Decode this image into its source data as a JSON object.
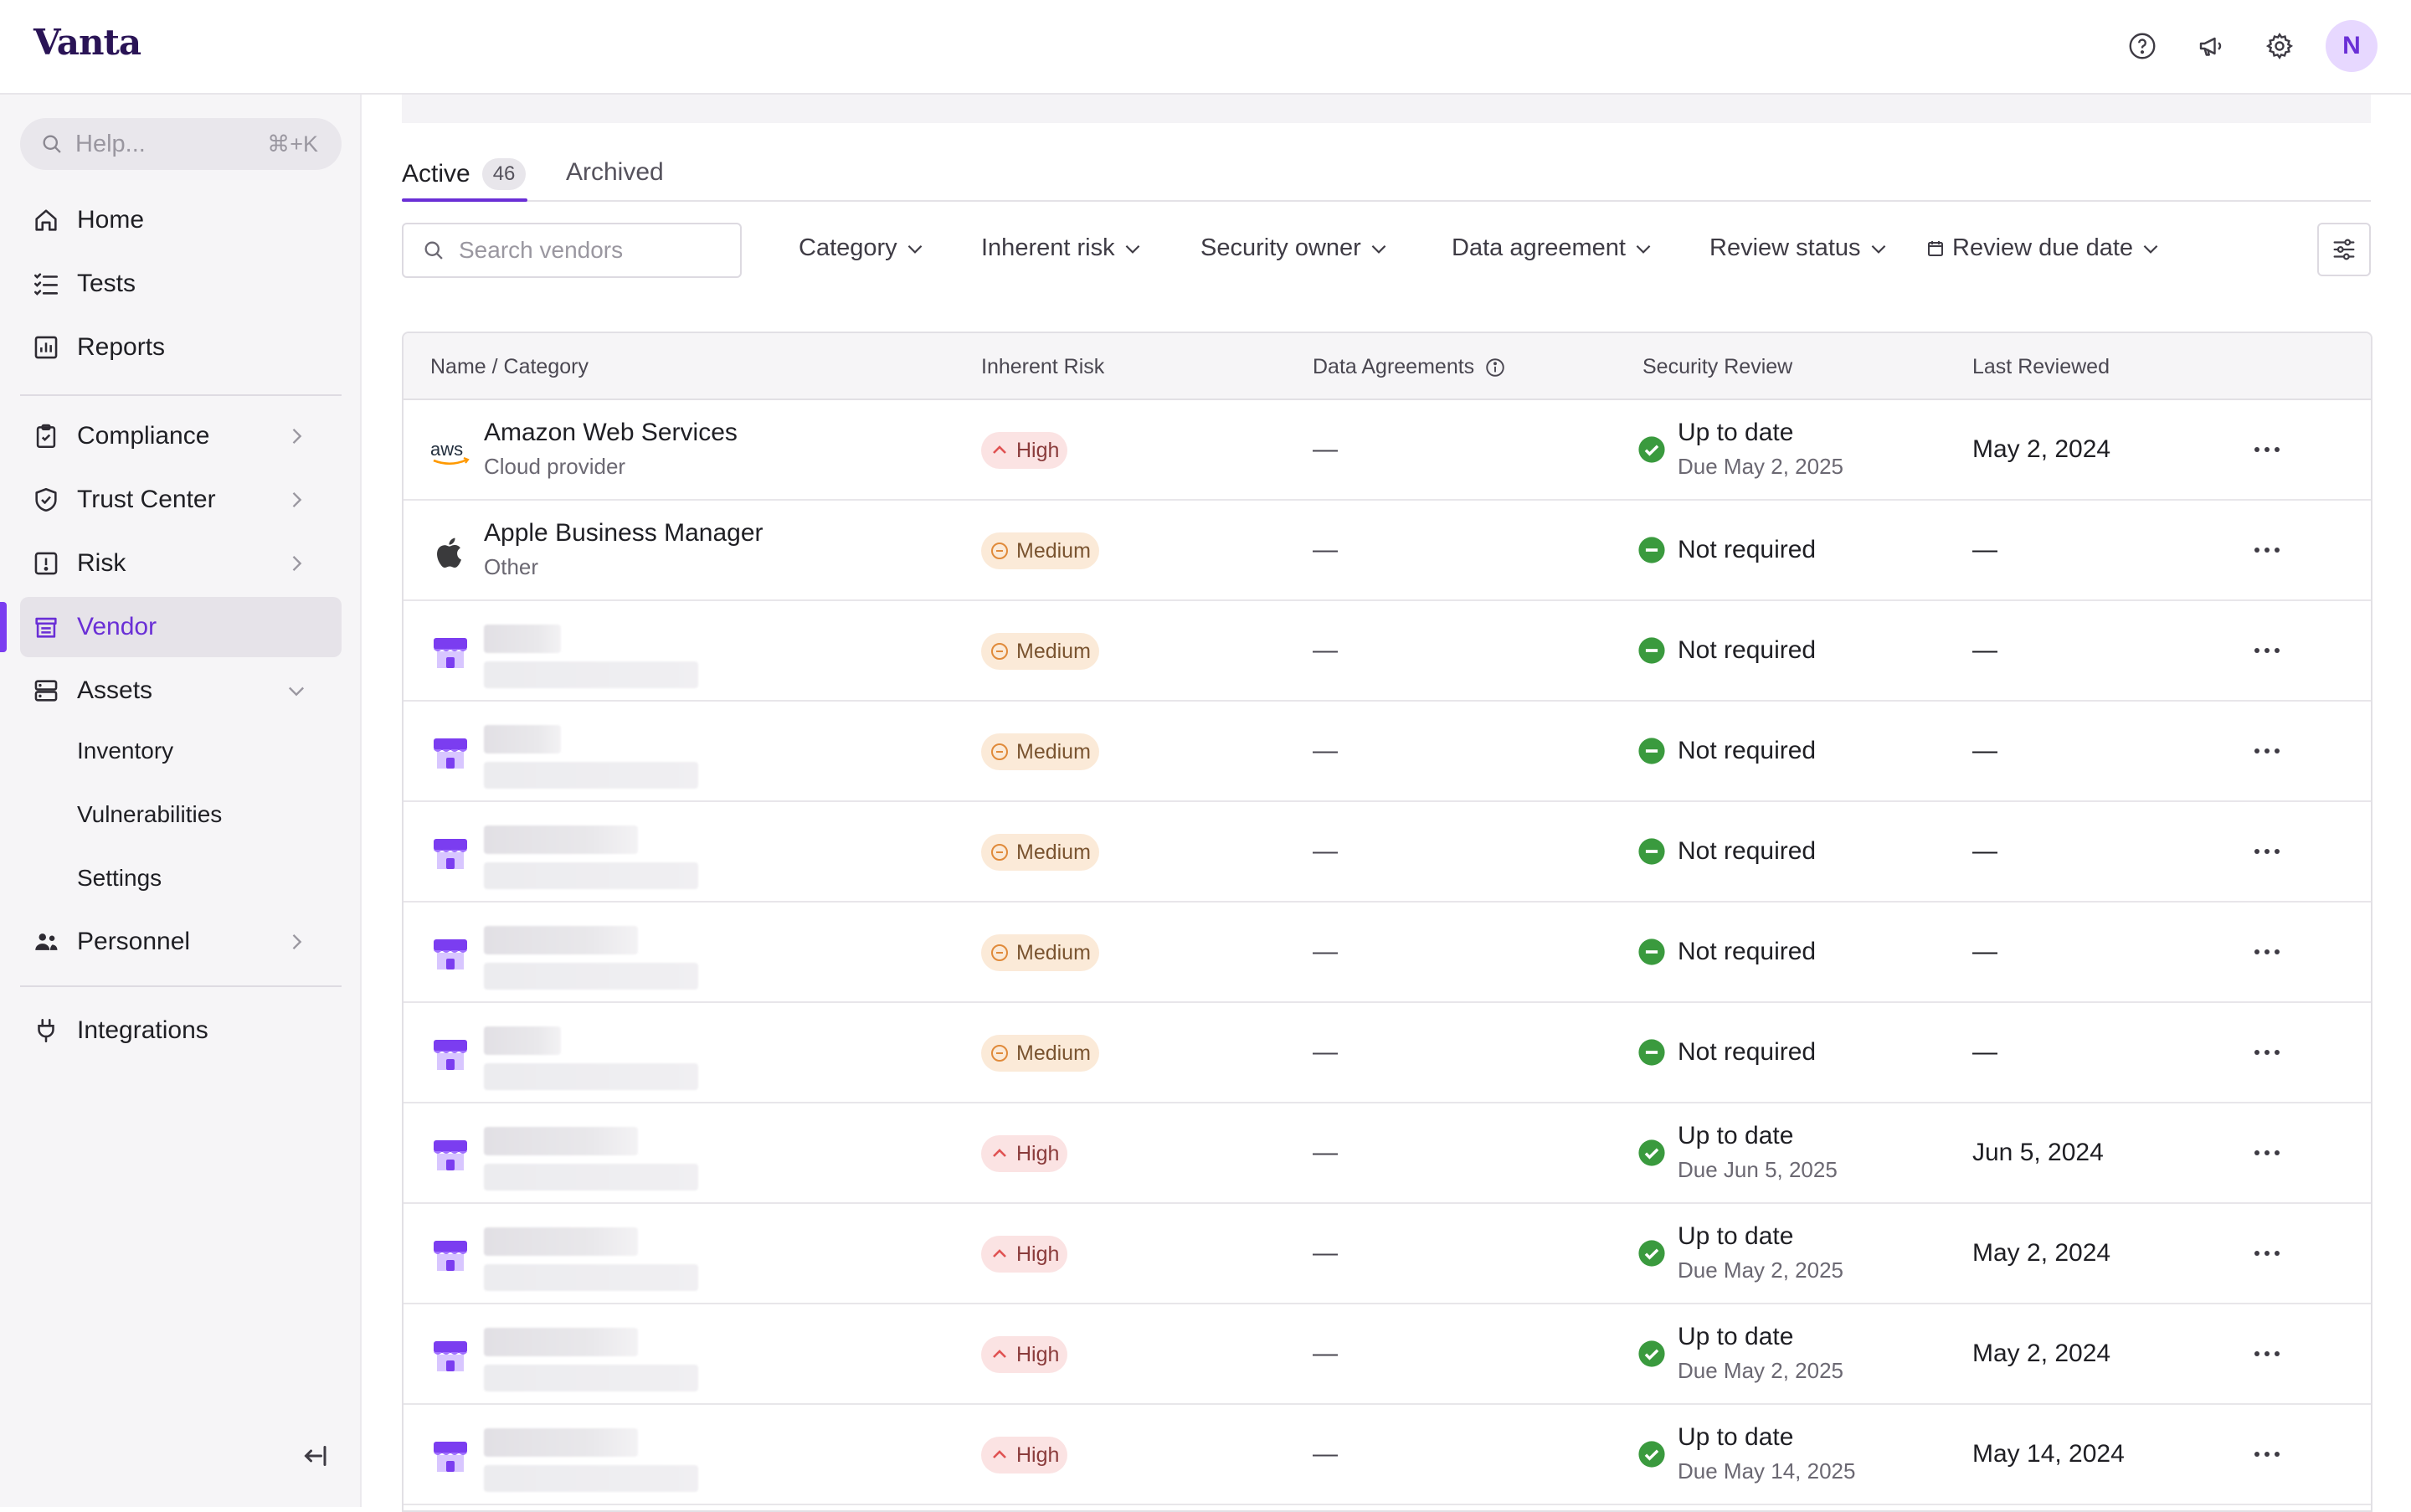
{
  "app": {
    "logo": "Vanta",
    "avatar_initial": "N"
  },
  "help": {
    "placeholder": "Help...",
    "shortcut": "⌘+K"
  },
  "nav": {
    "home": "Home",
    "tests": "Tests",
    "reports": "Reports",
    "compliance": "Compliance",
    "trust_center": "Trust Center",
    "risk": "Risk",
    "vendor": "Vendor",
    "assets": "Assets",
    "inventory": "Inventory",
    "vulnerabilities": "Vulnerabilities",
    "settings": "Settings",
    "personnel": "Personnel",
    "integrations": "Integrations"
  },
  "tabs": {
    "active_label": "Active",
    "active_count": "46",
    "archived_label": "Archived"
  },
  "filters": {
    "search_placeholder": "Search vendors",
    "category": "Category",
    "inherent_risk": "Inherent risk",
    "security_owner": "Security owner",
    "data_agreement": "Data agreement",
    "review_status": "Review status",
    "review_due_date": "Review due date"
  },
  "table": {
    "headers": {
      "name": "Name / Category",
      "risk": "Inherent Risk",
      "agreements": "Data Agreements",
      "review": "Security Review",
      "last": "Last Reviewed"
    },
    "rows": [
      {
        "name": "Amazon Web Services",
        "category": "Cloud provider",
        "risk": "High",
        "agreements": "—",
        "review": "Up to date",
        "due": "Due May 2, 2025",
        "last": "May 2, 2024"
      },
      {
        "name": "Apple Business Manager",
        "category": "Other",
        "risk": "Medium",
        "agreements": "—",
        "review": "Not required",
        "due": "",
        "last": "—"
      },
      {
        "name": "",
        "category": "",
        "risk": "Medium",
        "agreements": "—",
        "review": "Not required",
        "due": "",
        "last": "—"
      },
      {
        "name": "",
        "category": "",
        "risk": "Medium",
        "agreements": "—",
        "review": "Not required",
        "due": "",
        "last": "—"
      },
      {
        "name": "",
        "category": "",
        "risk": "Medium",
        "agreements": "—",
        "review": "Not required",
        "due": "",
        "last": "—"
      },
      {
        "name": "",
        "category": "",
        "risk": "Medium",
        "agreements": "—",
        "review": "Not required",
        "due": "",
        "last": "—"
      },
      {
        "name": "",
        "category": "",
        "risk": "Medium",
        "agreements": "—",
        "review": "Not required",
        "due": "",
        "last": "—"
      },
      {
        "name": "",
        "category": "",
        "risk": "High",
        "agreements": "—",
        "review": "Up to date",
        "due": "Due Jun 5, 2025",
        "last": "Jun 5, 2024"
      },
      {
        "name": "",
        "category": "",
        "risk": "High",
        "agreements": "—",
        "review": "Up to date",
        "due": "Due May 2, 2025",
        "last": "May 2, 2024"
      },
      {
        "name": "",
        "category": "",
        "risk": "High",
        "agreements": "—",
        "review": "Up to date",
        "due": "Due May 2, 2025",
        "last": "May 2, 2024"
      },
      {
        "name": "",
        "category": "",
        "risk": "High",
        "agreements": "—",
        "review": "Up to date",
        "due": "Due May 14, 2025",
        "last": "May 14, 2024"
      }
    ]
  },
  "icons": {
    "brand_accent": "#6a2fd6",
    "status_ok": "#3a9a3e",
    "risk_high": "#e05252",
    "risk_medium": "#e08a3a"
  }
}
